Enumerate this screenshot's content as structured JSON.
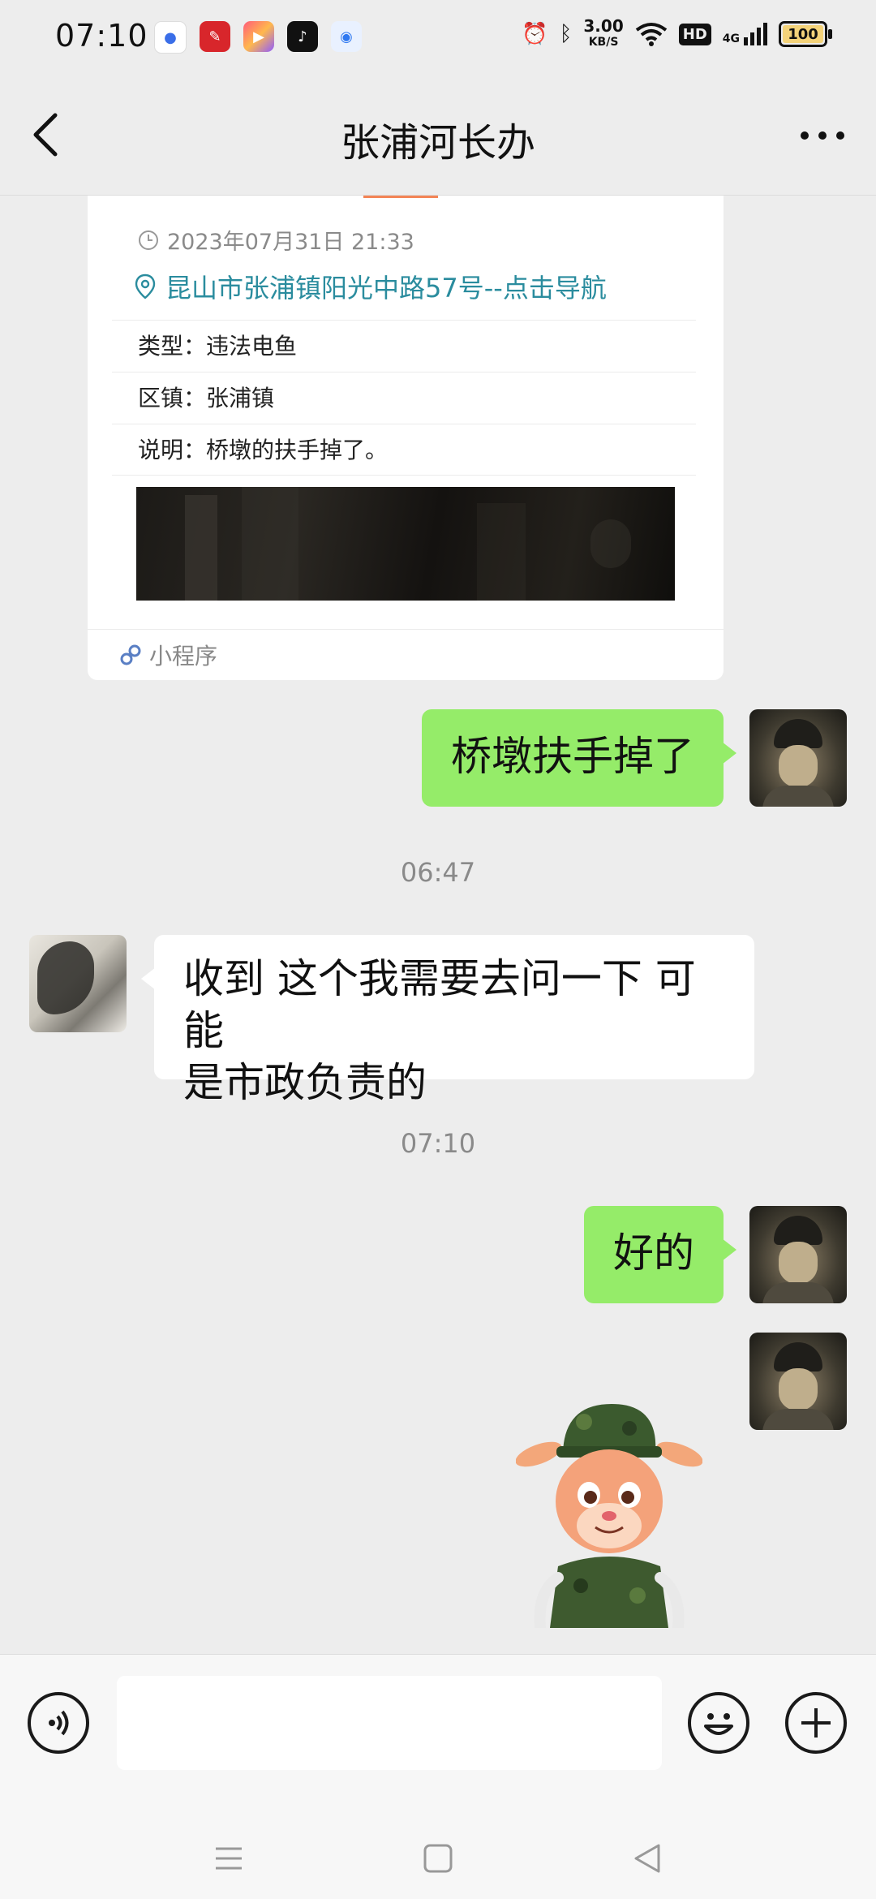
{
  "status_bar": {
    "time": "07:10",
    "net_speed_value": "3.00",
    "net_speed_unit": "KB/S",
    "hd": "HD",
    "network": "4G",
    "battery": "100",
    "app_icons": [
      "baidu-icon",
      "xuexi-icon",
      "video-icon",
      "tiktok-icon",
      "browser-icon"
    ]
  },
  "nav": {
    "title": "张浦河长办"
  },
  "card": {
    "time": "2023年07月31日 21:33",
    "location": "昆山市张浦镇阳光中路57号--点击导航",
    "rows": [
      {
        "label": "类型：",
        "value": "违法电鱼"
      },
      {
        "label": "区镇：",
        "value": "张浦镇"
      },
      {
        "label": "说明：",
        "value": "桥墩的扶手掉了。"
      }
    ],
    "footer": "小程序"
  },
  "messages": [
    {
      "sender": "me",
      "text": "桥墩扶手掉了"
    },
    {
      "timestamp": "06:47"
    },
    {
      "sender": "them",
      "line1": "收到 这个我需要去问一下 可能",
      "line2": "是市政负责的"
    },
    {
      "timestamp": "07:10"
    },
    {
      "sender": "me",
      "text": "好的"
    },
    {
      "sender": "me",
      "sticker": "cartoon-deer-soldier-sticker"
    }
  ],
  "timestamps": [
    "06:47",
    "07:10"
  ],
  "colors": {
    "background": "#ededed",
    "my_bubble": "#95ec69",
    "their_bubble": "#ffffff",
    "link": "#2a8c9e"
  }
}
